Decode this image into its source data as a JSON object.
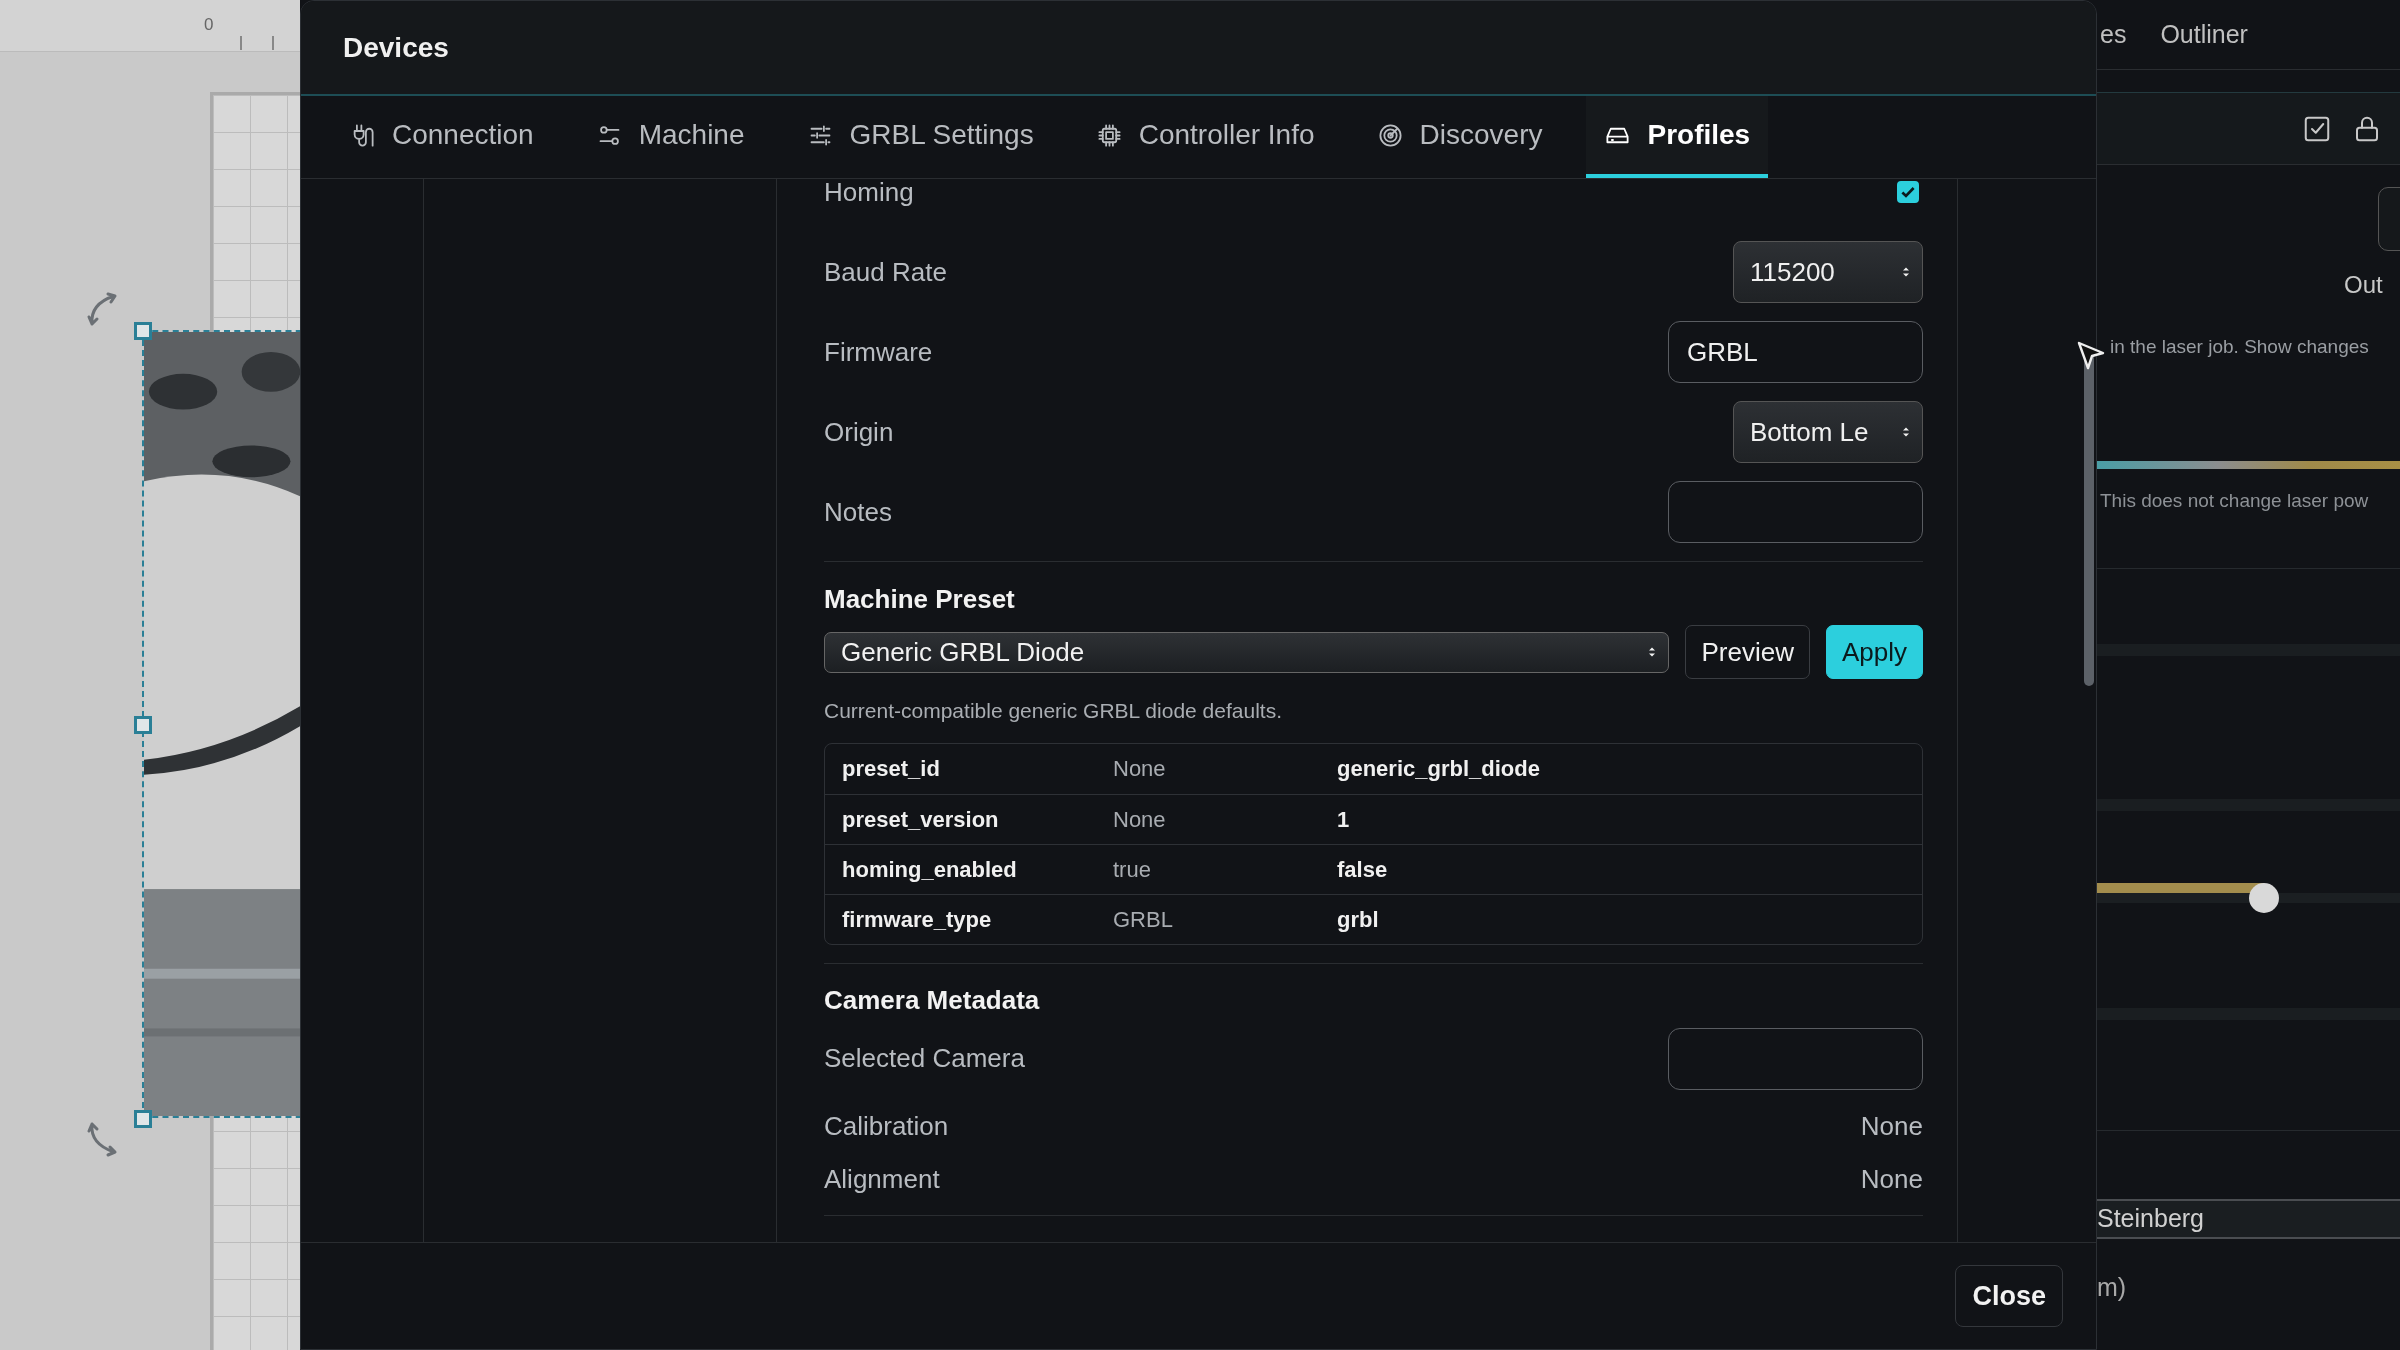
{
  "canvas": {
    "ruler_label": "0"
  },
  "modal": {
    "title": "Devices",
    "tabs": [
      {
        "label": "Connection",
        "selected": false
      },
      {
        "label": "Machine",
        "selected": false
      },
      {
        "label": "GRBL Settings",
        "selected": false
      },
      {
        "label": "Controller Info",
        "selected": false
      },
      {
        "label": "Discovery",
        "selected": false
      },
      {
        "label": "Profiles",
        "selected": true
      }
    ],
    "fields": [
      {
        "kind": "checkbox",
        "label": "Homing",
        "checked": true
      },
      {
        "kind": "select",
        "label": "Baud Rate",
        "value": "115200"
      },
      {
        "kind": "input",
        "label": "Firmware",
        "value": "GRBL"
      },
      {
        "kind": "select",
        "label": "Origin",
        "value": "Bottom Le"
      },
      {
        "kind": "input",
        "label": "Notes"
      }
    ],
    "machine_preset": {
      "heading": "Machine Preset",
      "select_value": "Generic GRBL Diode",
      "buttons": [
        {
          "label": "Preview",
          "kind": "outline"
        },
        {
          "label": "Apply",
          "kind": "primary"
        }
      ],
      "help": "Current-compatible generic GRBL diode defaults.",
      "table": {
        "rows": [
          [
            "preset_id",
            "None",
            "generic_grbl_diode"
          ],
          [
            "preset_version",
            "None",
            "1"
          ],
          [
            "homing_enabled",
            "true",
            "false"
          ],
          [
            "firmware_type",
            "GRBL",
            "grbl"
          ]
        ]
      }
    },
    "camera_metadata": {
      "heading": "Camera Metadata",
      "fields": [
        {
          "kind": "input",
          "label": "Selected Camera"
        },
        {
          "kind": "value",
          "label": "Calibration",
          "value": "None"
        },
        {
          "kind": "value",
          "label": "Alignment",
          "value": "None"
        }
      ]
    },
    "footer": {
      "close": "Close"
    }
  },
  "side_panel": {
    "tabs": [
      {
        "label": "es"
      },
      {
        "label": "Outliner"
      }
    ],
    "out_label": "Out",
    "hint": "in the laser job. Show changes",
    "note": "This does not change laser pow",
    "slider": {
      "level": 0.55
    },
    "list_item": "Steinberg",
    "footer_text": "m)"
  }
}
